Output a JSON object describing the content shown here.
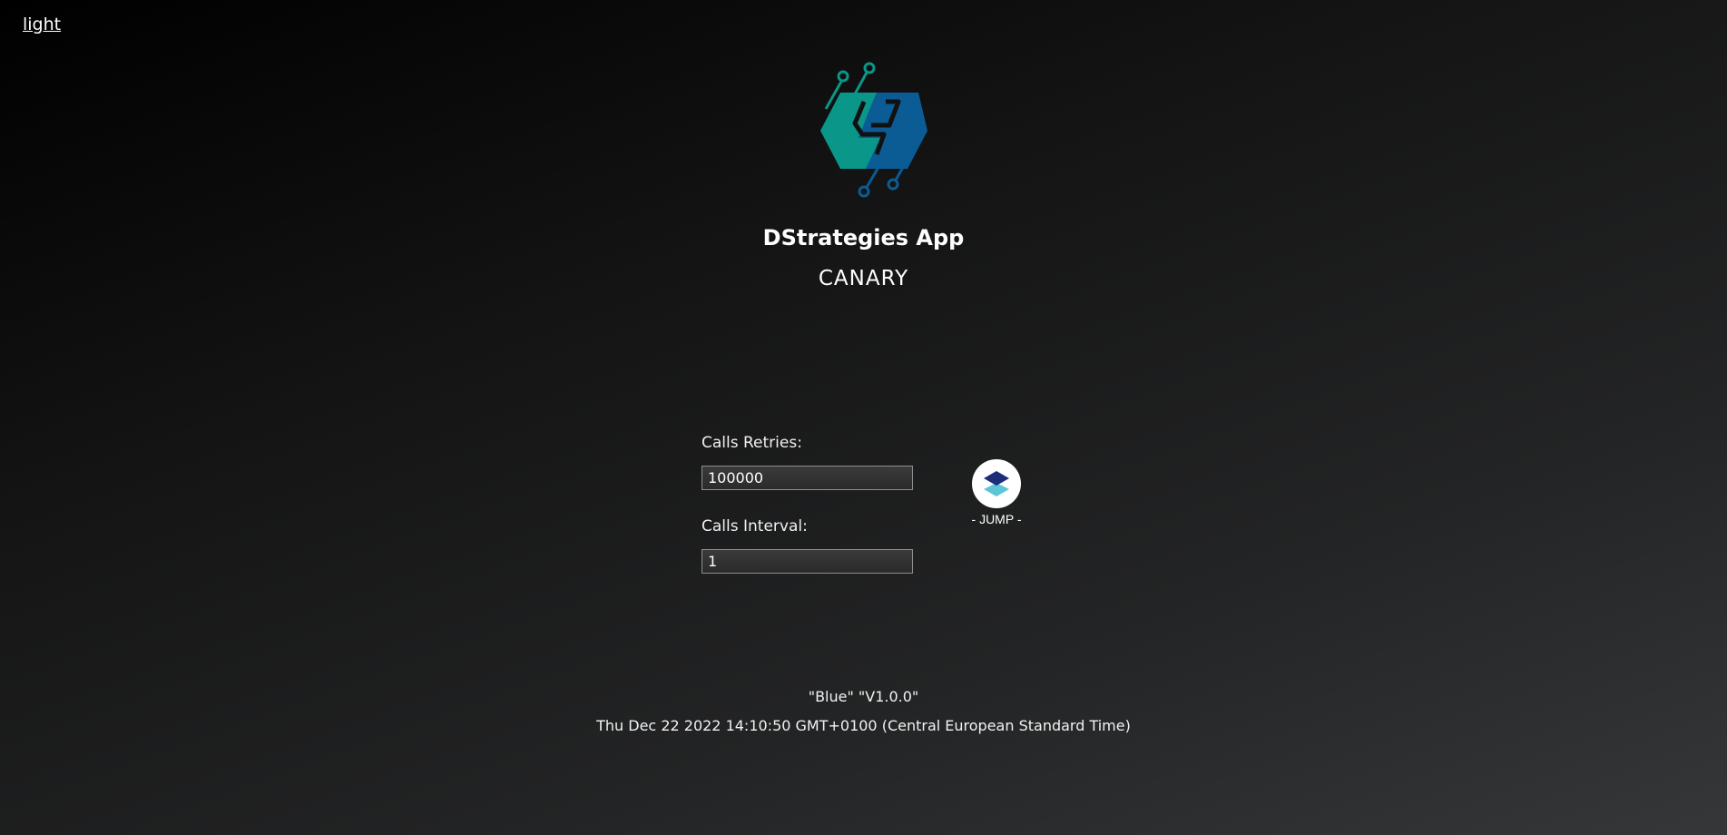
{
  "theme_toggle": {
    "label": "light"
  },
  "header": {
    "logo_icon": "dstrategies-hexagon-logo-icon",
    "title": "DStrategies App",
    "channel": "CANARY"
  },
  "form": {
    "retries_label": "Calls Retries:",
    "retries_value": "100000",
    "interval_label": "Calls Interval:",
    "interval_value": "1"
  },
  "jump": {
    "icon": "layers-icon",
    "label": "- JUMP -"
  },
  "footer": {
    "version": "\"Blue\" \"V1.0.0\"",
    "timestamp": "Thu Dec 22 2022 14:10:50 GMT+0100 (Central European Standard Time)"
  },
  "colors": {
    "logo_teal": "#0a9688",
    "logo_blue": "#0b5b94",
    "jump_dark": "#1e2d7a",
    "jump_light": "#5cc6d6"
  }
}
